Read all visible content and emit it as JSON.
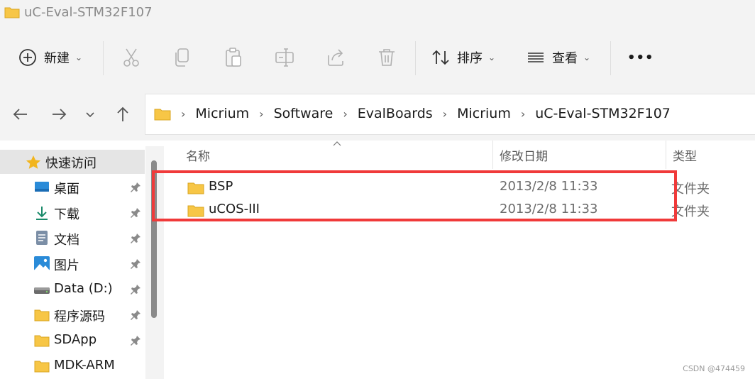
{
  "window": {
    "title": "uC-Eval-STM32F107"
  },
  "toolbar": {
    "new_label": "新建",
    "sort_label": "排序",
    "view_label": "查看",
    "more_label": "•••"
  },
  "address": {
    "crumbs": [
      "Micrium",
      "Software",
      "EvalBoards",
      "Micrium",
      "uC-Eval-STM32F107"
    ]
  },
  "sidebar": {
    "items": [
      {
        "label": "快速访问",
        "icon": "star-icon",
        "pinned": false
      },
      {
        "label": "桌面",
        "icon": "desktop-icon",
        "pinned": true
      },
      {
        "label": "下载",
        "icon": "download-icon",
        "pinned": true
      },
      {
        "label": "文档",
        "icon": "document-icon",
        "pinned": true
      },
      {
        "label": "图片",
        "icon": "picture-icon",
        "pinned": true
      },
      {
        "label": "Data (D:)",
        "icon": "drive-icon",
        "pinned": true
      },
      {
        "label": "程序源码",
        "icon": "folder-icon",
        "pinned": true
      },
      {
        "label": "SDApp",
        "icon": "folder-icon",
        "pinned": true
      },
      {
        "label": "MDK-ARM",
        "icon": "folder-icon",
        "pinned": false
      }
    ]
  },
  "columns": {
    "name": "名称",
    "date": "修改日期",
    "type": "类型"
  },
  "files": [
    {
      "name": "BSP",
      "date": "2013/2/8 11:33",
      "type": "文件夹"
    },
    {
      "name": "uCOS-III",
      "date": "2013/2/8 11:33",
      "type": "文件夹"
    }
  ],
  "watermark": "CSDN @474459",
  "colors": {
    "highlight": "#f03a3a",
    "folder": "#f7c646",
    "accent": "#0a64c8"
  }
}
